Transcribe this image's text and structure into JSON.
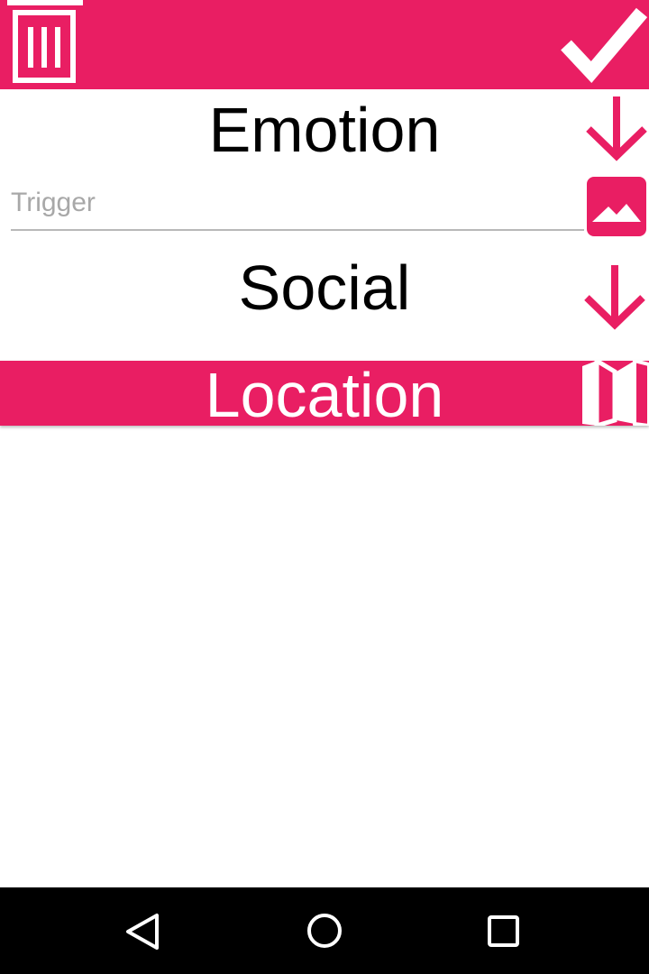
{
  "header": {
    "delete_icon": "trash-icon",
    "confirm_icon": "checkmark-icon"
  },
  "emotion": {
    "title": "Emotion",
    "expand_icon": "arrow-down-icon"
  },
  "trigger": {
    "placeholder": "Trigger",
    "value": "",
    "image_icon": "image-icon"
  },
  "social": {
    "title": "Social",
    "expand_icon": "arrow-down-icon"
  },
  "location": {
    "label": "Location",
    "map_icon": "map-icon"
  },
  "navigation": {
    "back_icon": "back-triangle-icon",
    "home_icon": "home-circle-icon",
    "recents_icon": "recents-square-icon"
  },
  "colors": {
    "accent": "#e91e63",
    "navbar": "#000000",
    "text": "#000000",
    "placeholder": "#a8a8a8"
  }
}
